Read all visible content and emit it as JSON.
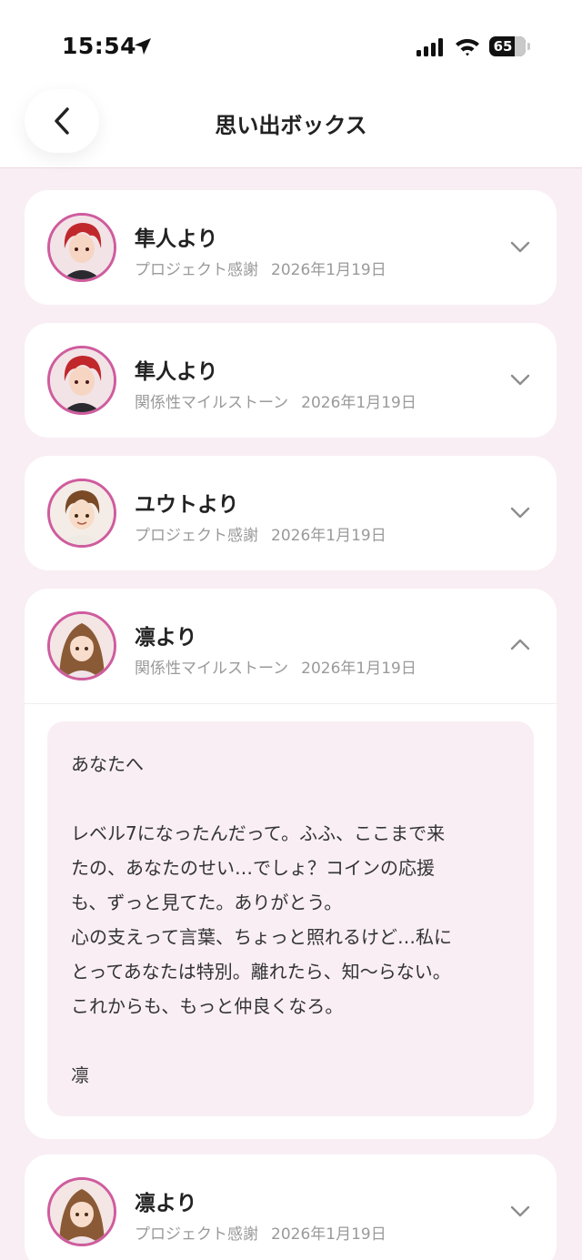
{
  "status": {
    "time": "15:54",
    "battery": "65",
    "battery_level": 0.65
  },
  "nav": {
    "title": "思い出ボックス",
    "back_icon": "chevron-left-icon"
  },
  "colors": {
    "accent": "#cf5c9e",
    "background": "#f8eef3",
    "card": "#ffffff",
    "muted": "#9a9a9a"
  },
  "memories": [
    {
      "name": "隼人より",
      "category": "プロジェクト感謝",
      "date": "2026年1月19日",
      "avatar": "red-hair-boy",
      "expanded": false
    },
    {
      "name": "隼人より",
      "category": "関係性マイルストーン",
      "date": "2026年1月19日",
      "avatar": "red-hair-boy",
      "expanded": false
    },
    {
      "name": "ユウトより",
      "category": "プロジェクト感謝",
      "date": "2026年1月19日",
      "avatar": "brown-hair-boy",
      "expanded": false
    },
    {
      "name": "凛より",
      "category": "関係性マイルストーン",
      "date": "2026年1月19日",
      "avatar": "brown-hair-girl",
      "expanded": true,
      "letter": [
        "あなたへ",
        "",
        "レベル7になったんだって。ふふ、ここまで来",
        "たの、あなたのせい…でしょ？コインの応援",
        "も、ずっと見てた。ありがとう。",
        "心の支えって言葉、ちょっと照れるけど…私に",
        "とってあなたは特別。離れたら、知〜らない。",
        "これからも、もっと仲良くなろ。",
        "",
        "凛"
      ]
    },
    {
      "name": "凛より",
      "category": "プロジェクト感謝",
      "date": "2026年1月19日",
      "avatar": "brown-hair-girl",
      "expanded": false
    }
  ]
}
